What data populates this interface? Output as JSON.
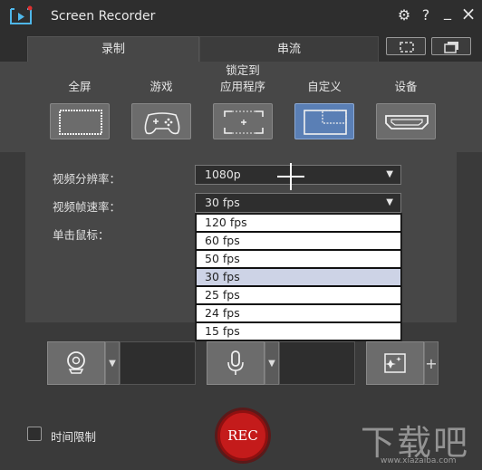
{
  "app": {
    "title": "Screen Recorder",
    "accent": "#5a7fb5",
    "rec_color": "#c41b1b"
  },
  "titlebar": {
    "icons": [
      "gear-icon",
      "help-icon",
      "minimize-icon",
      "close-icon"
    ],
    "help": "?",
    "minimize": "_",
    "close": "×"
  },
  "tabs": [
    {
      "label": "录制",
      "active": true
    },
    {
      "label": "串流",
      "active": false
    }
  ],
  "modes": [
    {
      "label": "全屏",
      "icon": "fullscreen-icon"
    },
    {
      "label": "游戏",
      "icon": "gamepad-icon"
    },
    {
      "label": "锁定到\n应用程序",
      "line1": "锁定到",
      "line2": "应用程序",
      "icon": "lock-app-icon"
    },
    {
      "label": "自定义",
      "icon": "custom-area-icon",
      "selected": true
    },
    {
      "label": "设备",
      "icon": "hdmi-device-icon"
    }
  ],
  "settings": {
    "resolution_label": "视频分辨率：",
    "resolution_value": "1080p",
    "fps_label": "视频帧速率：",
    "fps_value": "30 fps",
    "mouse_label": "单击鼠标：",
    "fps_options": [
      "120 fps",
      "60 fps",
      "50 fps",
      "30 fps",
      "25 fps",
      "24 fps",
      "15 fps"
    ],
    "fps_selected_index": 3
  },
  "devices": {
    "webcam_icon": "webcam-icon",
    "mic_icon": "microphone-icon",
    "effects_icon": "effects-icon",
    "add": "+"
  },
  "bottom": {
    "time_limit_label": "时间限制",
    "rec_label": "REC"
  },
  "watermark": {
    "text": "下载吧",
    "url": "www.xiazaiba.com"
  }
}
